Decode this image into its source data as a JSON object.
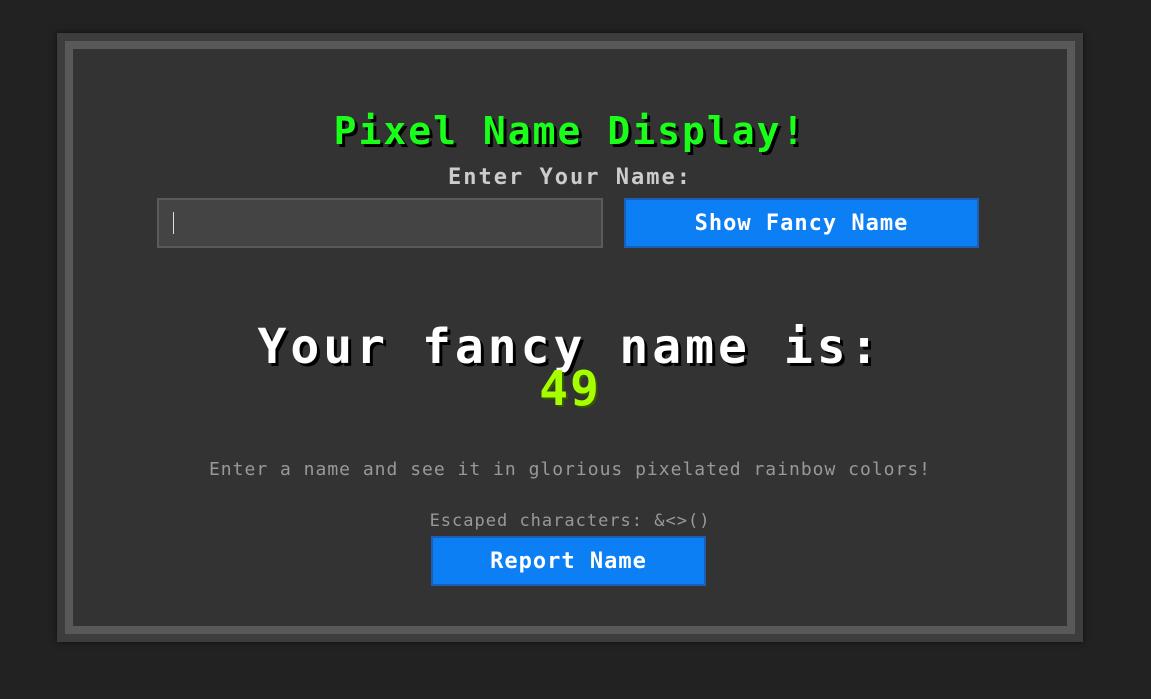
{
  "app": {
    "title": "Pixel Name Display!",
    "prompt_label": "Enter Your Name:"
  },
  "form": {
    "name_input_value": "",
    "show_button_label": "Show Fancy Name"
  },
  "result": {
    "label": "Your fancy name is:",
    "value": "49",
    "value_color": "#a5ff00"
  },
  "info": {
    "description": "Enter a name and see it in glorious pixelated rainbow colors!",
    "escaped_label": "Escaped characters: &<>()"
  },
  "actions": {
    "report_button_label": "Report Name"
  },
  "colors": {
    "title": "#19ff19",
    "button": "#0d7ff5",
    "background": "#222222",
    "panel": "#333333"
  }
}
